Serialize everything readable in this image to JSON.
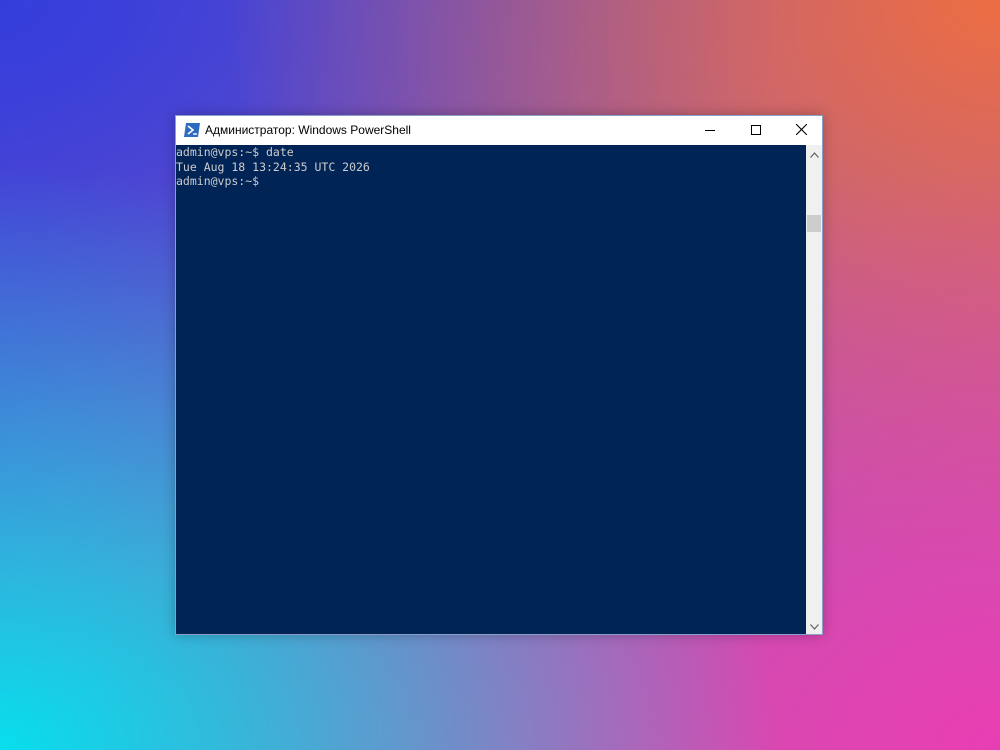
{
  "window": {
    "title": "Администратор: Windows PowerShell",
    "icon": "powershell-icon",
    "controls": [
      "minimize-icon",
      "maximize-icon",
      "close-icon"
    ]
  },
  "console": {
    "lines": [
      "admin@vps:~$ date",
      "Tue Aug 18 13:24:35 UTC 2026",
      "admin@vps:~$"
    ]
  },
  "colors": {
    "console_background": "#012456",
    "console_text": "#cccccc",
    "titlebar": "#ffffff",
    "scrollbar_track": "#f0f0f0",
    "scrollbar_thumb": "#cdcdcd"
  }
}
